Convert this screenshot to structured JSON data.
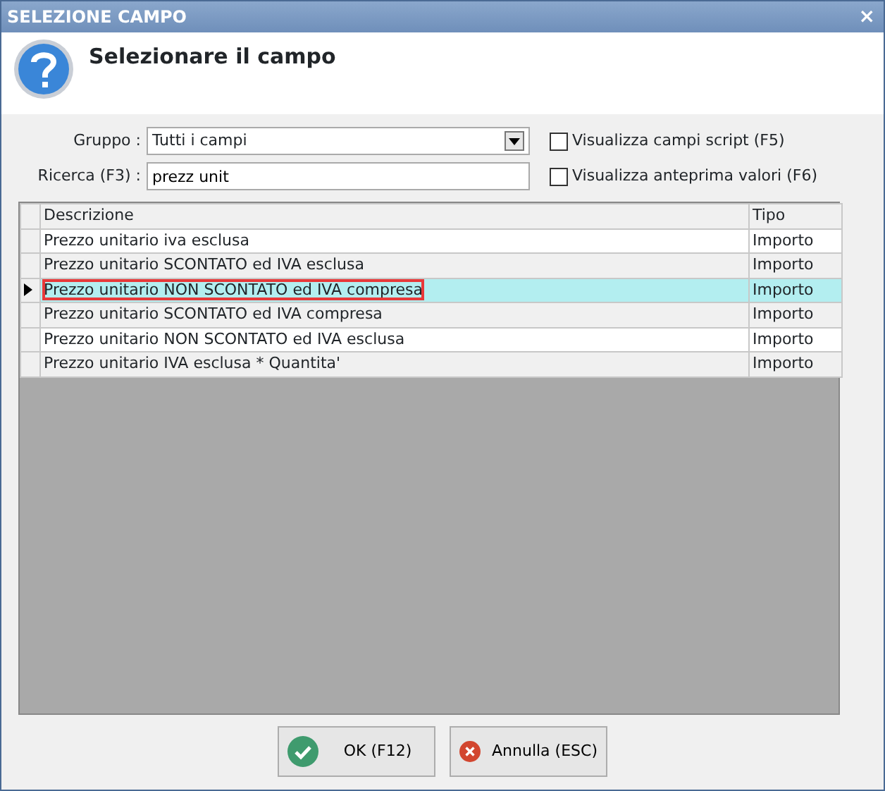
{
  "window": {
    "title": "SELEZIONE CAMPO",
    "close": "×"
  },
  "header": {
    "title": "Selezionare il campo"
  },
  "gruppo": {
    "label": "Gruppo :",
    "value": "Tutti i campi"
  },
  "ricerca": {
    "label": "Ricerca (F3) :",
    "value": "prezz unit"
  },
  "options": [
    {
      "label": "Visualizza campi script (F5)",
      "checked": false
    },
    {
      "label": "Visualizza anteprima valori (F6)",
      "checked": false
    }
  ],
  "table": {
    "columns": [
      "Descrizione",
      "Tipo"
    ],
    "rows": [
      {
        "cells": [
          "Prezzo unitario iva esclusa",
          "Importo"
        ],
        "selected": false,
        "highlighted": false
      },
      {
        "cells": [
          "Prezzo unitario SCONTATO ed IVA esclusa",
          "Importo"
        ],
        "selected": false,
        "highlighted": false
      },
      {
        "cells": [
          "Prezzo unitario NON SCONTATO ed IVA compresa",
          "Importo"
        ],
        "selected": true,
        "highlighted": true
      },
      {
        "cells": [
          "Prezzo unitario SCONTATO ed IVA compresa",
          "Importo"
        ],
        "selected": false,
        "highlighted": false
      },
      {
        "cells": [
          "Prezzo unitario NON SCONTATO ed IVA esclusa",
          "Importo"
        ],
        "selected": false,
        "highlighted": false
      },
      {
        "cells": [
          "Prezzo unitario IVA esclusa * Quantita'",
          "Importo"
        ],
        "selected": false,
        "highlighted": false
      }
    ]
  },
  "buttons": [
    {
      "kind": "ok",
      "label": "OK (F12)"
    },
    {
      "kind": "cancel",
      "label": "Annulla (ESC)"
    }
  ]
}
